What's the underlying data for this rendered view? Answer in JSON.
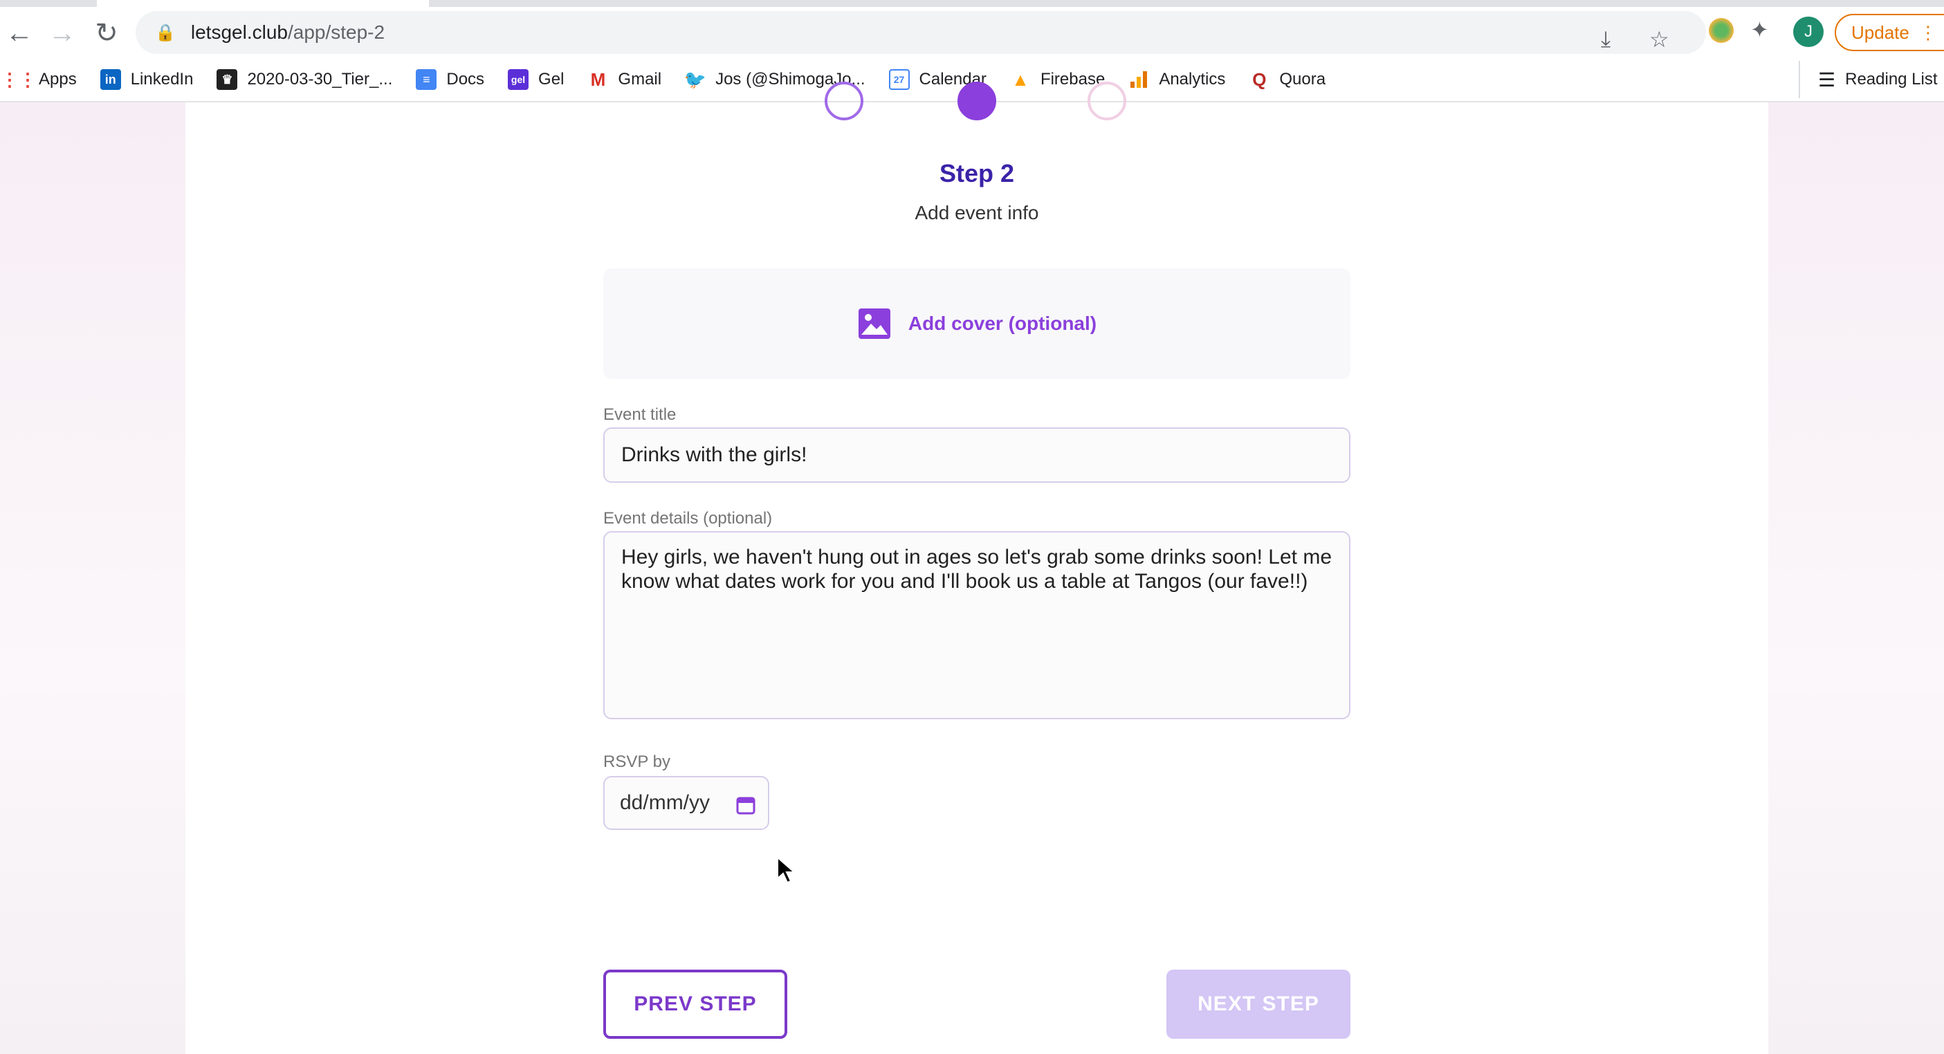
{
  "browser": {
    "url_domain": "letsgel.club",
    "url_path": "/app/step-2",
    "update_label": "Update",
    "profile_initial": "J",
    "bookmarks": [
      {
        "label": "Apps",
        "icon": "apps-grid-icon"
      },
      {
        "label": "LinkedIn",
        "icon": "linkedin-icon"
      },
      {
        "label": "2020-03-30_Tier_...",
        "icon": "bookmark-favicon-icon"
      },
      {
        "label": "Docs",
        "icon": "docs-icon"
      },
      {
        "label": "Gel",
        "icon": "gel-icon"
      },
      {
        "label": "Gmail",
        "icon": "gmail-icon"
      },
      {
        "label": "Jos (@ShimogaJo...",
        "icon": "twitter-icon"
      },
      {
        "label": "Calendar",
        "icon": "calendar-icon"
      },
      {
        "label": "Firebase",
        "icon": "firebase-icon"
      },
      {
        "label": "Analytics",
        "icon": "analytics-icon"
      },
      {
        "label": "Quora",
        "icon": "quora-icon"
      }
    ],
    "reading_list": "Reading List"
  },
  "form": {
    "step_title": "Step 2",
    "step_subtitle": "Add event info",
    "cover_label": "Add cover (optional)",
    "event_title_label": "Event title",
    "event_title_value": "Drinks with the girls!",
    "event_details_label": "Event details (optional)",
    "event_details_value": "Hey girls, we haven't hung out in ages so let's grab some drinks soon! Let me know what dates work for you and I'll book us a table at Tangos (our fave!!)",
    "rsvp_label": "RSVP by",
    "rsvp_placeholder": "dd/mm/yy",
    "prev_label": "PREV STEP",
    "next_label": "NEXT STEP"
  },
  "colors": {
    "accent": "#7b39c9",
    "title": "#3b23a8",
    "next_disabled": "#d4c6f5"
  }
}
